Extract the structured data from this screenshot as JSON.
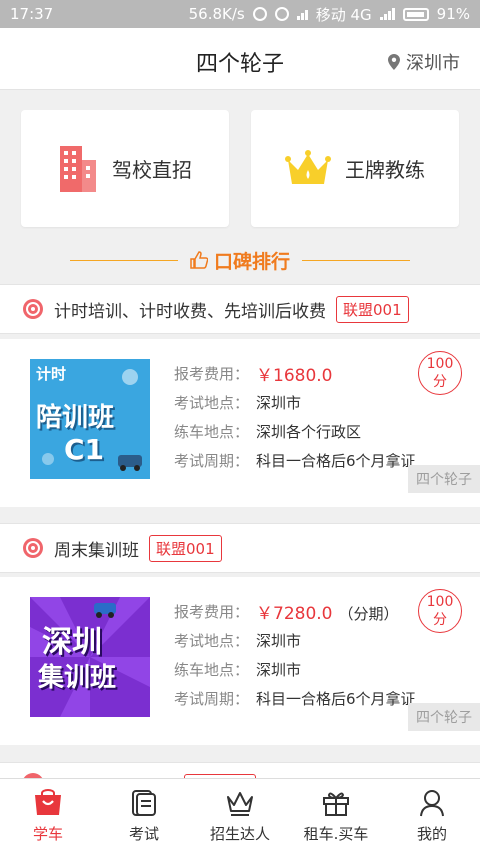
{
  "status": {
    "time": "17:37",
    "speed": "56.8K/s",
    "carrier": "移动 4G",
    "battery": "91%"
  },
  "header": {
    "title": "四个轮子",
    "city": "深圳市"
  },
  "quick": [
    {
      "label": "驾校直招",
      "icon": "building-icon"
    },
    {
      "label": "王牌教练",
      "icon": "crown-icon"
    }
  ],
  "ranking": {
    "label": "口碑排行"
  },
  "sections": [
    {
      "name": "计时培训、计时收费、先培训后收费",
      "badge": "联盟001",
      "thumb": {
        "line1": "计时",
        "line2": "陪训班",
        "line3": "C1"
      },
      "fee_label": "报考费用：",
      "fee": "￥1680.0",
      "fee_note": "",
      "exam_place_label": "考试地点：",
      "exam_place": "深圳市",
      "practice_place_label": "练车地点：",
      "practice_place": "深圳各个行政区",
      "cycle_label": "考试周期：",
      "cycle": "科目一合格后6个月拿证",
      "score": "100",
      "score_unit": "分",
      "watermark": "四个轮子"
    },
    {
      "name": "周末集训班",
      "badge": "联盟001",
      "thumb": {
        "line1": "深圳",
        "line2": "集训班"
      },
      "fee_label": "报考费用：",
      "fee": "￥7280.0",
      "fee_note": "（分期）",
      "exam_place_label": "考试地点：",
      "exam_place": "深圳市",
      "practice_place_label": "练车地点：",
      "practice_place": "深圳市",
      "cycle_label": "考试周期：",
      "cycle": "科目一合格后6个月拿证",
      "score": "100",
      "score_unit": "分",
      "watermark": "四个轮子"
    }
  ],
  "tabs": [
    {
      "label": "学车",
      "icon": "shopping-bag-icon",
      "active": true
    },
    {
      "label": "考试",
      "icon": "document-icon",
      "active": false
    },
    {
      "label": "招生达人",
      "icon": "crown-outline-icon",
      "active": false
    },
    {
      "label": "租车.买车",
      "icon": "gift-icon",
      "active": false
    },
    {
      "label": "我的",
      "icon": "person-icon",
      "active": false
    }
  ],
  "colors": {
    "accent": "#e8373c",
    "orange": "#f07b1e",
    "background": "#f0f0f0"
  }
}
